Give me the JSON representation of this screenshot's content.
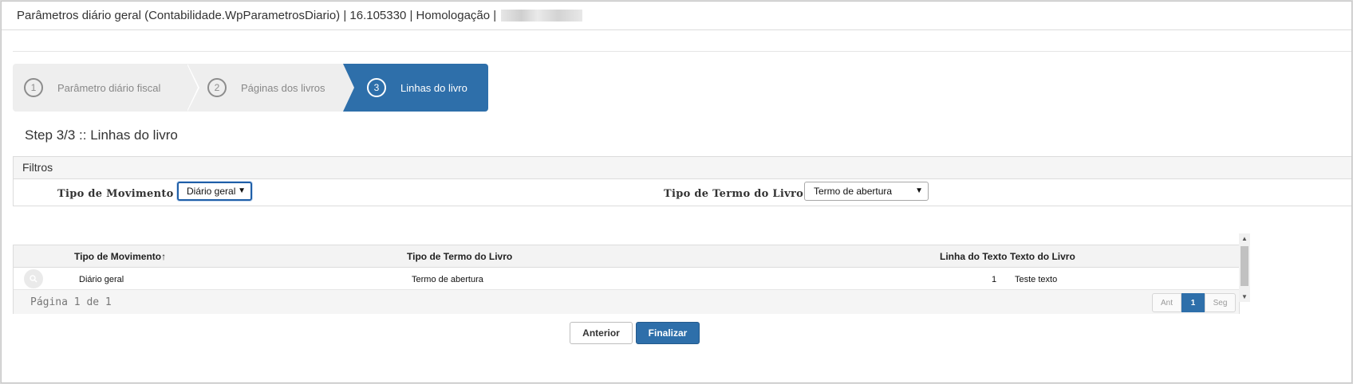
{
  "window": {
    "title": "Parâmetros diário geral (Contabilidade.WpParametrosDiario) | 16.105330 | Homologação |"
  },
  "wizard": {
    "steps": [
      {
        "number": "1",
        "label": "Parâmetro diário fiscal",
        "active": false
      },
      {
        "number": "2",
        "label": "Páginas dos livros",
        "active": false
      },
      {
        "number": "3",
        "label": "Linhas do livro",
        "active": true
      }
    ],
    "step_title": "Step 3/3 :: Linhas do livro"
  },
  "filters": {
    "header": "Filtros",
    "tipo_movimento_label": "Tipo de Movimento",
    "tipo_movimento_value": "Diário geral",
    "tipo_termo_label": "Tipo de Termo do Livro",
    "tipo_termo_value": "Termo de abertura"
  },
  "grid": {
    "columns": [
      "Tipo de Movimento",
      "Tipo de Termo do Livro",
      "Linha do Texto",
      "Texto do Livro"
    ],
    "sort_indicator": "↑",
    "rows": [
      {
        "tipo_movimento": "Diário geral",
        "tipo_termo": "Termo de abertura",
        "linha": "1",
        "texto": "Teste texto"
      }
    ],
    "page_info": "Página 1 de 1",
    "pager": {
      "prev": "Ant",
      "current": "1",
      "next": "Seg"
    }
  },
  "buttons": {
    "prev": "Anterior",
    "finish": "Finalizar"
  },
  "icons": {
    "search": "search-icon",
    "select_arrow": "chevron-down-icon"
  },
  "colors": {
    "accent": "#2e6faa"
  }
}
